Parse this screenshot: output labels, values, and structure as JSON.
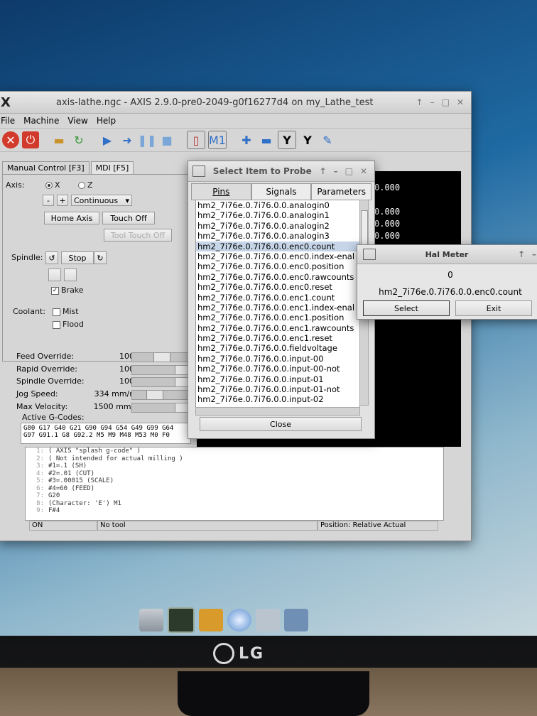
{
  "window": {
    "title": "axis-lathe.ngc - AXIS 2.9.0-pre0-2049-g0f16277d4 on my_Lathe_test",
    "menu": [
      "File",
      "Machine",
      "View",
      "Help"
    ]
  },
  "tabs": [
    "Manual Control [F3]",
    "MDI [F5]"
  ],
  "manual": {
    "axis_label": "Axis:",
    "axis_x": "X",
    "axis_z": "Z",
    "minus": "-",
    "plus": "+",
    "jog_mode": "Continuous",
    "home_axis": "Home Axis",
    "touch_off": "Touch Off",
    "tool_touch_off": "Tool Touch Off",
    "spindle_label": "Spindle:",
    "stop": "Stop",
    "brake": "Brake",
    "coolant_label": "Coolant:",
    "mist": "Mist",
    "flood": "Flood"
  },
  "overrides": [
    {
      "name": "Feed Override:",
      "value": "100 %"
    },
    {
      "name": "Rapid Override:",
      "value": "100 %"
    },
    {
      "name": "Spindle Override:",
      "value": "100 %"
    },
    {
      "name": "Jog Speed:",
      "value": "334 mm/min"
    },
    {
      "name": "Max Velocity:",
      "value": "1500 mm/min"
    }
  ],
  "active_gcodes_label": "Active G-Codes:",
  "active_gcodes": [
    "G80 G17 G40 G21 G90 G94 G54 G49 G99 G64",
    "G97 G91.1 G8 G92.2 M5 M9 M48 M53 M0 F0"
  ],
  "dro": [
    "0.000",
    "0.000",
    "0.000",
    "0.000"
  ],
  "gcode_lines": [
    {
      "n": "1:",
      "t": "( AXIS \"splash g-code\" )"
    },
    {
      "n": "2:",
      "t": "( Not intended for actual milling )"
    },
    {
      "n": "3:",
      "t": "#1=.1 (SH)"
    },
    {
      "n": "4:",
      "t": "#2=.01 (CUT)"
    },
    {
      "n": "5:",
      "t": "#3=.00015 (SCALE)"
    },
    {
      "n": "6:",
      "t": "#4=60 (FEED)"
    },
    {
      "n": "7:",
      "t": "G20"
    },
    {
      "n": "8:",
      "t": "(Character: 'E') M1"
    },
    {
      "n": "9:",
      "t": "F#4"
    }
  ],
  "status": {
    "state": "ON",
    "tool": "No tool",
    "position": "Position: Relative Actual"
  },
  "probe": {
    "title": "Select Item to Probe",
    "tabs": [
      "Pins",
      "Signals",
      "Parameters"
    ],
    "items": [
      "hm2_7i76e.0.7i76.0.0.analogin0",
      "hm2_7i76e.0.7i76.0.0.analogin1",
      "hm2_7i76e.0.7i76.0.0.analogin2",
      "hm2_7i76e.0.7i76.0.0.analogin3",
      "hm2_7i76e.0.7i76.0.0.enc0.count",
      "hm2_7i76e.0.7i76.0.0.enc0.index-enal",
      "hm2_7i76e.0.7i76.0.0.enc0.position",
      "hm2_7i76e.0.7i76.0.0.enc0.rawcounts",
      "hm2_7i76e.0.7i76.0.0.enc0.reset",
      "hm2_7i76e.0.7i76.0.0.enc1.count",
      "hm2_7i76e.0.7i76.0.0.enc1.index-enal",
      "hm2_7i76e.0.7i76.0.0.enc1.position",
      "hm2_7i76e.0.7i76.0.0.enc1.rawcounts",
      "hm2_7i76e.0.7i76.0.0.enc1.reset",
      "hm2_7i76e.0.7i76.0.0.fieldvoltage",
      "hm2_7i76e.0.7i76.0.0.input-00",
      "hm2_7i76e.0.7i76.0.0.input-00-not",
      "hm2_7i76e.0.7i76.0.0.input-01",
      "hm2_7i76e.0.7i76.0.0.input-01-not",
      "hm2_7i76e.0.7i76.0.0.input-02"
    ],
    "selected_index": 4,
    "close": "Close"
  },
  "hal": {
    "title": "Hal Meter",
    "value": "0",
    "pin": "hm2_7i76e.0.7i76.0.0.enc0.count",
    "select": "Select",
    "exit": "Exit"
  },
  "monitor": {
    "brand": "LG"
  }
}
